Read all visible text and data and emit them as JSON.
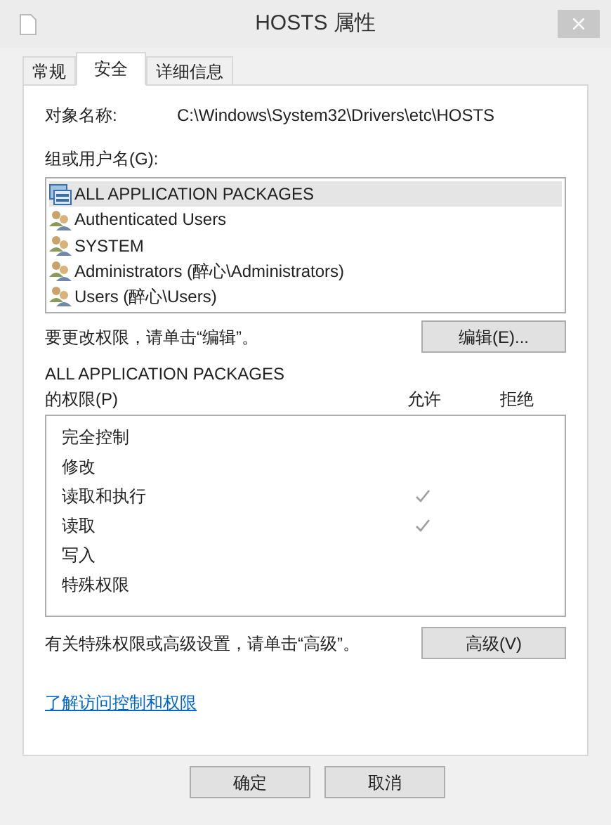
{
  "window": {
    "title": "HOSTS 属性"
  },
  "tabs": [
    {
      "label": "常规",
      "selected": false
    },
    {
      "label": "安全",
      "selected": true
    },
    {
      "label": "详细信息",
      "selected": false
    }
  ],
  "object_name": {
    "label": "对象名称:",
    "value": "C:\\Windows\\System32\\Drivers\\etc\\HOSTS"
  },
  "groups": {
    "label": "组或用户名(G):",
    "items": [
      {
        "name": "ALL APPLICATION PACKAGES",
        "kind": "package",
        "selected": true
      },
      {
        "name": "Authenticated Users",
        "kind": "group",
        "selected": false
      },
      {
        "name": "SYSTEM",
        "kind": "group",
        "selected": false
      },
      {
        "name": "Administrators (醉心\\Administrators)",
        "kind": "group",
        "selected": false
      },
      {
        "name": "Users (醉心\\Users)",
        "kind": "group",
        "selected": false
      }
    ]
  },
  "edit_hint": "要更改权限，请单击“编辑”。",
  "edit_button": "编辑(E)...",
  "permissions": {
    "title": "ALL APPLICATION PACKAGES",
    "subtitle": "的权限(P)",
    "allow_header": "允许",
    "deny_header": "拒绝",
    "rows": [
      {
        "name": "完全控制",
        "allow": false
      },
      {
        "name": "修改",
        "allow": false
      },
      {
        "name": "读取和执行",
        "allow": true
      },
      {
        "name": "读取",
        "allow": true
      },
      {
        "name": "写入",
        "allow": false
      },
      {
        "name": "特殊权限",
        "allow": false
      }
    ]
  },
  "advanced_hint": "有关特殊权限或高级设置，请单击“高级”。",
  "advanced_button": "高级(V)",
  "learn_link": "了解访问控制和权限",
  "buttons": [
    "确定",
    "取消"
  ]
}
